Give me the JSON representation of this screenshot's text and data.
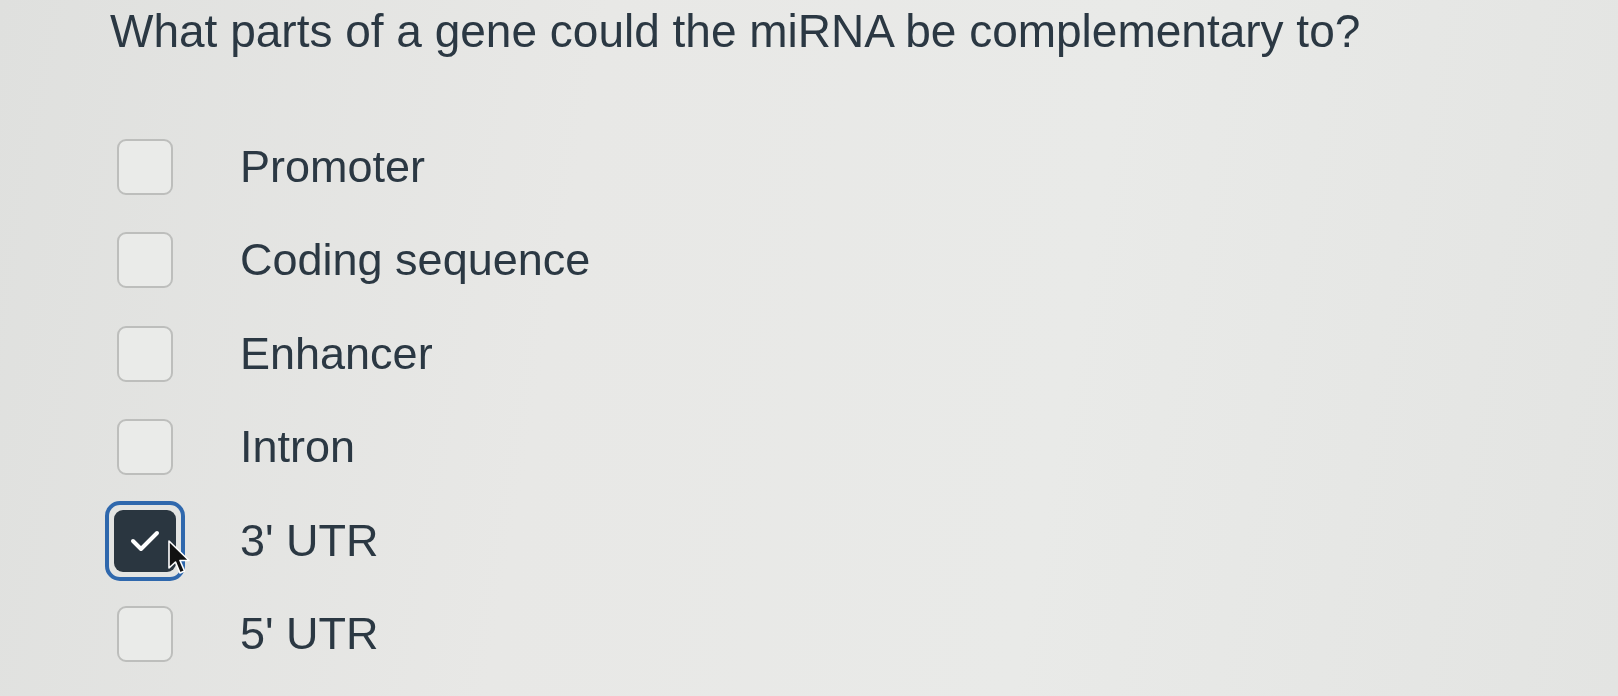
{
  "question": "What parts of a gene could the miRNA be complementary to?",
  "options": [
    {
      "label": "Promoter",
      "checked": false,
      "focused": false,
      "hovered": false
    },
    {
      "label": "Coding sequence",
      "checked": false,
      "focused": false,
      "hovered": false
    },
    {
      "label": "Enhancer",
      "checked": false,
      "focused": false,
      "hovered": false
    },
    {
      "label": "Intron",
      "checked": false,
      "focused": false,
      "hovered": false
    },
    {
      "label": "3' UTR",
      "checked": true,
      "focused": true,
      "hovered": true
    },
    {
      "label": "5' UTR",
      "checked": false,
      "focused": false,
      "hovered": false
    }
  ]
}
